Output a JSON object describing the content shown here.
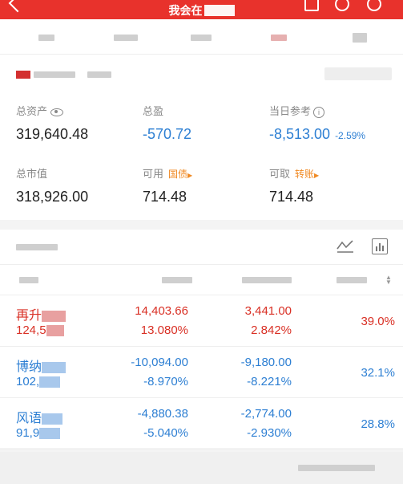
{
  "header": {
    "title": "我会在",
    "colors": {
      "bar": "#e8322c",
      "text": "#ffffff"
    }
  },
  "account": {
    "total_assets": {
      "label": "总资产",
      "value": "319,640.48"
    },
    "total_pnl": {
      "label": "总盈",
      "value": "-570.72"
    },
    "today_ref": {
      "label": "当日参考",
      "value": "-8,513.00",
      "pct": "-2.59%"
    },
    "market_value": {
      "label": "总市值",
      "value": "318,926.00"
    },
    "available": {
      "label": "可用",
      "tag": "国债",
      "value": "714.48"
    },
    "withdrawable": {
      "label": "可取",
      "tag": "转账",
      "value": "714.48"
    }
  },
  "holdings": [
    {
      "name": "再升",
      "qty": "124,5",
      "pnl": "14,403.66",
      "pnl_pct": "13.080%",
      "today": "3,441.00",
      "today_pct": "2.842%",
      "ratio": "39.0%",
      "tone": "up"
    },
    {
      "name": "博纳",
      "qty": "102,",
      "pnl": "-10,094.00",
      "pnl_pct": "-8.970%",
      "today": "-9,180.00",
      "today_pct": "-8.221%",
      "ratio": "32.1%",
      "tone": "down"
    },
    {
      "name": "风语",
      "qty": "91,9",
      "pnl": "-4,880.38",
      "pnl_pct": "-5.040%",
      "today": "-2,774.00",
      "today_pct": "-2.930%",
      "ratio": "28.8%",
      "tone": "down"
    }
  ],
  "icons": [
    "back-icon",
    "document-icon",
    "search-icon",
    "more-icon",
    "eye-icon",
    "info-icon",
    "trend-chart-icon",
    "bar-chart-icon",
    "sort-icon"
  ],
  "colors": {
    "up": "#d93025",
    "down": "#2d7fd3",
    "tag": "#f08a24"
  }
}
